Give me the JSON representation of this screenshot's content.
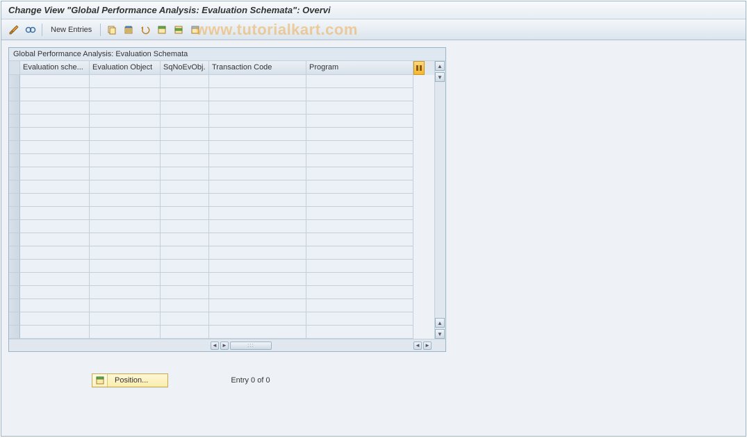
{
  "title": "Change View \"Global Performance Analysis: Evaluation Schemata\": Overvi",
  "toolbar": {
    "new_entries": "New Entries"
  },
  "watermark": "www.tutorialkart.com",
  "panel": {
    "title": "Global Performance Analysis: Evaluation Schemata",
    "columns": {
      "c1": "Evaluation sche...",
      "c2": "Evaluation Object",
      "c3": "SqNoEvObj.",
      "c4": "Transaction Code",
      "c5": "Program"
    }
  },
  "position_button": "Position...",
  "entry_text": "Entry 0 of 0",
  "icons": {
    "pencils": "pencils-icon",
    "glasses": "glasses-icon",
    "copy": "copy-icon",
    "save": "save-icon",
    "undo": "undo-icon",
    "select_all": "select-all-icon",
    "select_block": "select-block-icon",
    "deselect": "deselect-icon"
  }
}
